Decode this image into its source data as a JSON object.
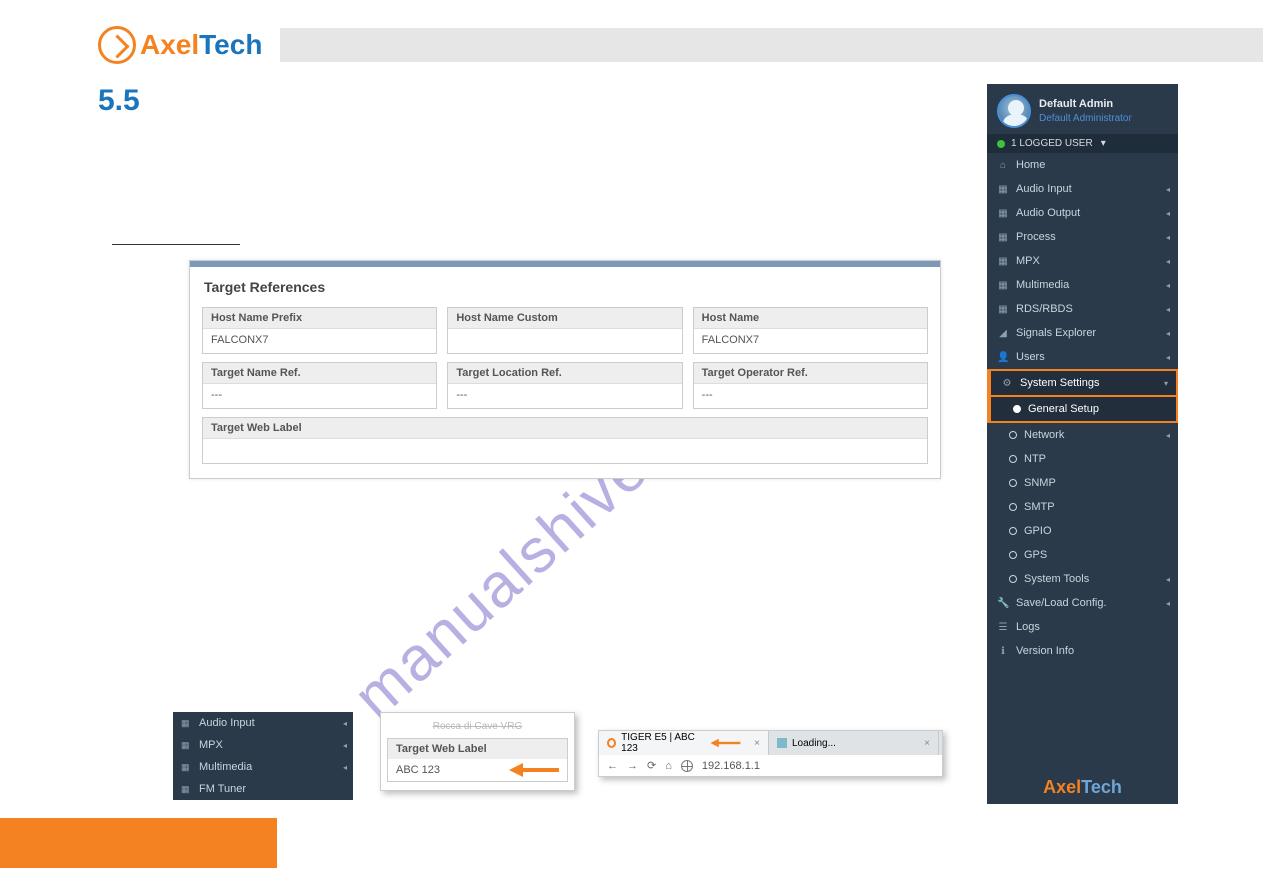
{
  "section_number": "5.5",
  "logo": {
    "part1": "Axel",
    "part2": "Tech"
  },
  "form": {
    "title": "Target References",
    "fields": {
      "host_name_prefix": {
        "label": "Host Name Prefix",
        "value": "FALCONX7"
      },
      "host_name_custom": {
        "label": "Host Name Custom",
        "value": ""
      },
      "host_name": {
        "label": "Host Name",
        "value": "FALCONX7"
      },
      "target_name_ref": {
        "label": "Target Name Ref.",
        "value": "---"
      },
      "target_location_ref": {
        "label": "Target Location Ref.",
        "value": "---"
      },
      "target_operator_ref": {
        "label": "Target Operator Ref.",
        "value": "---"
      },
      "target_web_label": {
        "label": "Target Web Label",
        "value": ""
      }
    }
  },
  "sidebar": {
    "user_name": "Default Admin",
    "user_role": "Default Administrator",
    "logged_text": "1 LOGGED USER",
    "items": {
      "home": "Home",
      "audio_input": "Audio Input",
      "audio_output": "Audio Output",
      "process": "Process",
      "mpx": "MPX",
      "multimedia": "Multimedia",
      "rds": "RDS/RBDS",
      "signals": "Signals Explorer",
      "users": "Users",
      "system_settings": "System Settings",
      "general_setup": "General Setup",
      "network": "Network",
      "ntp": "NTP",
      "snmp": "SNMP",
      "smtp": "SMTP",
      "gpio": "GPIO",
      "gps": "GPS",
      "system_tools": "System Tools",
      "save_load": "Save/Load Config.",
      "logs": "Logs",
      "version": "Version Info"
    }
  },
  "mini_nav": {
    "audio_input": "Audio Input",
    "mpx": "MPX",
    "multimedia": "Multimedia",
    "fm_tuner": "FM Tuner"
  },
  "web_label_panel": {
    "struck": "Rocca di Cave VRG",
    "label": "Target Web Label",
    "value": "ABC 123"
  },
  "browser": {
    "tab1_title": "TIGER E5 | ABC 123",
    "tab2_title": "Loading...",
    "url": "192.168.1.1"
  },
  "watermark": "manualshive.com"
}
